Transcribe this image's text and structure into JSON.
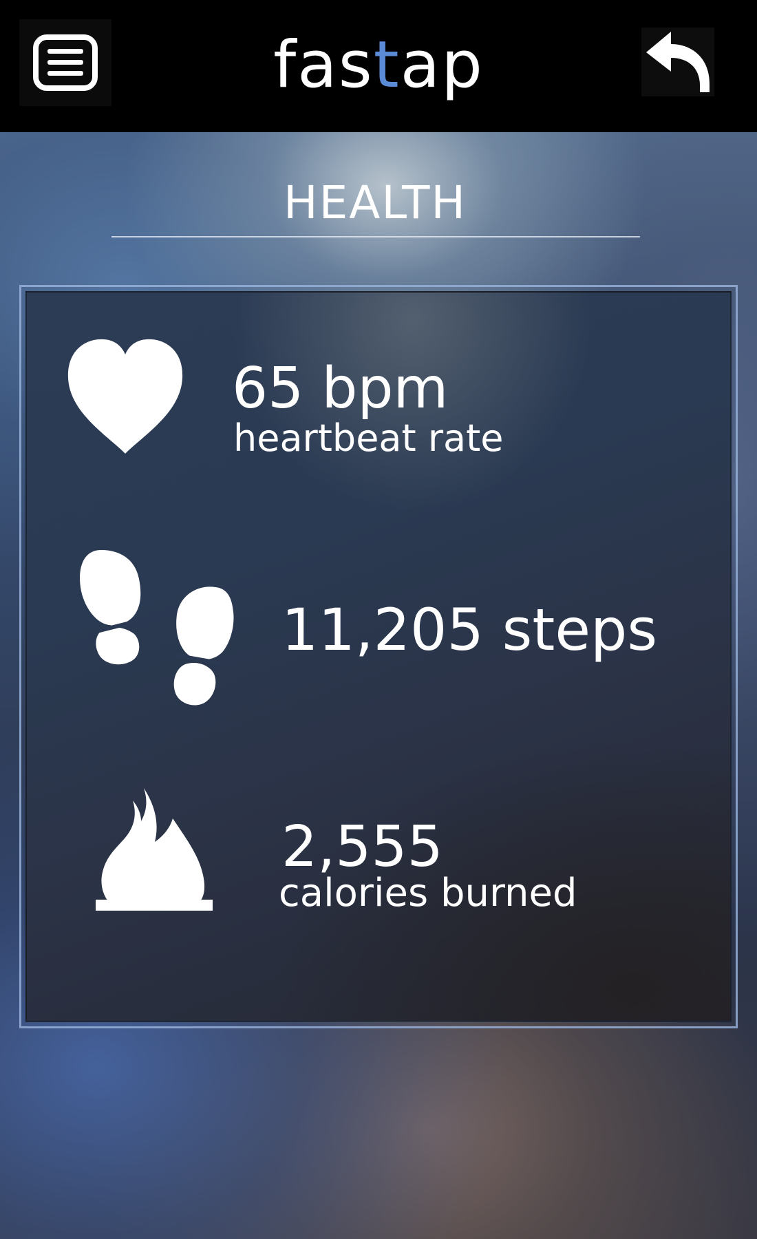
{
  "app": {
    "brand_prefix": "fas",
    "brand_accent": "t",
    "brand_suffix": "ap",
    "accent_color": "#5b8bd6"
  },
  "toolbar": {
    "menu_icon": "menu-icon",
    "back_icon": "back-arrow-icon"
  },
  "section": {
    "title": "HEALTH"
  },
  "stats": {
    "heartbeat": {
      "icon": "heart-icon",
      "value": "65 bpm",
      "label": "heartbeat rate"
    },
    "steps": {
      "icon": "footprints-icon",
      "value": "11,205 steps"
    },
    "calories": {
      "icon": "flame-icon",
      "value": "2,555",
      "label": "calories burned"
    }
  }
}
